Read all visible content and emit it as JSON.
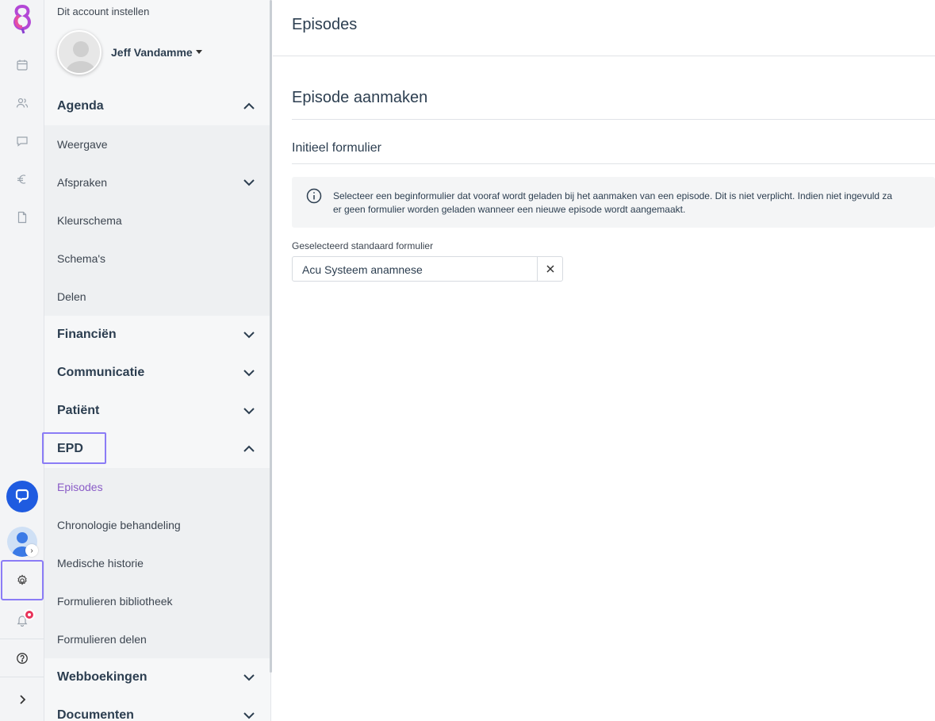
{
  "sidebar": {
    "account_label": "Dit account instellen",
    "user_name": "Jeff Vandamme",
    "sections": [
      {
        "label": "Agenda",
        "expanded": true,
        "items": [
          "Weergave",
          "Afspraken",
          "Kleurschema",
          "Schema's",
          "Delen"
        ]
      },
      {
        "label": "Financiën",
        "expanded": false
      },
      {
        "label": "Communicatie",
        "expanded": false
      },
      {
        "label": "Patiënt",
        "expanded": false
      },
      {
        "label": "EPD",
        "expanded": true,
        "items": [
          "Episodes",
          "Chronologie behandeling",
          "Medische historie",
          "Formulieren bibliotheek",
          "Formulieren delen"
        ]
      },
      {
        "label": "Webboekingen",
        "expanded": false
      },
      {
        "label": "Documenten",
        "expanded": false
      }
    ],
    "active_item": "Episodes"
  },
  "rail": {
    "icons": [
      "calendar-icon",
      "users-icon",
      "chat-icon",
      "euro-icon",
      "document-icon"
    ],
    "notification_count": "1"
  },
  "main": {
    "title": "Episodes",
    "section_title": "Episode aanmaken",
    "subsection_title": "Initieel formulier",
    "info_line1": "Selecteer een beginformulier dat vooraf wordt geladen bij het aanmaken van een episode. Dit is niet verplicht. Indien niet ingevuld za",
    "info_line2": "er geen formulier worden geladen wanneer een nieuwe episode wordt aangemaakt.",
    "field_label": "Geselecteerd standaard formulier",
    "field_value": "Acu Systeem anamnese"
  },
  "colors": {
    "accent": "#8a5cc7",
    "highlight_box": "#8b7cf6",
    "chat_button": "#1f5be0",
    "badge": "#e8335a"
  }
}
